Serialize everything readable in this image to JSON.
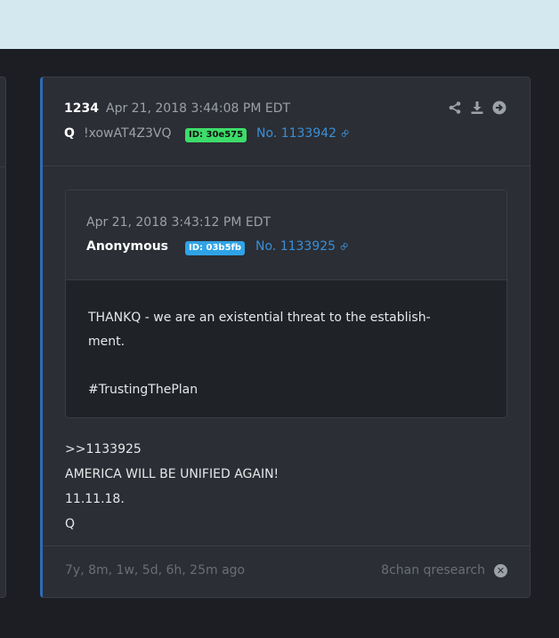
{
  "post": {
    "number": "1234",
    "date": "Apr 21, 2018 3:44:08 PM EDT",
    "author": "Q",
    "tripcode": "!xowAT4Z3VQ",
    "id_badge": "ID: 30e575",
    "post_link": "No. 1133942"
  },
  "quote": {
    "date": "Apr 21, 2018 3:43:12 PM EDT",
    "author": "Anonymous",
    "id_badge": "ID: 03b5fb",
    "post_link": "No. 1133925",
    "lines": [
      "THANKQ - we are an existential threat to the establish-",
      "ment.",
      "#TrustingThePlan"
    ]
  },
  "body": {
    "lines": [
      ">>1133925",
      "AMERICA WILL BE UNIFIED AGAIN!",
      "11.11.18.",
      "Q"
    ]
  },
  "footer": {
    "age": "7y, 8m, 1w, 5d, 6h, 25m ago",
    "source": "8chan qresearch"
  },
  "icons": {
    "share": "share-icon",
    "download": "download-icon",
    "goto": "arrow-right-circle-icon",
    "link": "link-icon",
    "close": "close-circle-icon"
  },
  "colors": {
    "accent": "#2e6ab8",
    "link": "#3a8fd8",
    "id_green": "#3ddc6a",
    "id_blue": "#2fa3e6"
  }
}
